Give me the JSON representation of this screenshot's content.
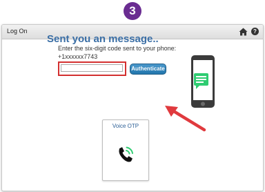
{
  "step": {
    "number": "3"
  },
  "window": {
    "title": "Log On"
  },
  "main": {
    "heading": "Sent you an message..",
    "instructions": "Enter the six-digit code sent to your phone:",
    "phone_number": "+1xxxxxx7743",
    "code_input": {
      "value": "",
      "placeholder": ""
    },
    "authenticate_label": "Authenticate"
  },
  "voice_otp": {
    "label": "Voice OTP"
  },
  "icons": {
    "home": "home-icon",
    "help": "help-icon",
    "phone": "smartphone-message-icon",
    "call": "phone-call-icon",
    "arrow": "red-arrow"
  },
  "colors": {
    "step_badge": "#6a2c91",
    "heading": "#3a6ea5",
    "button": "#2276ac",
    "highlight": "#d32f2f",
    "message_bubble": "#2ecc71"
  }
}
